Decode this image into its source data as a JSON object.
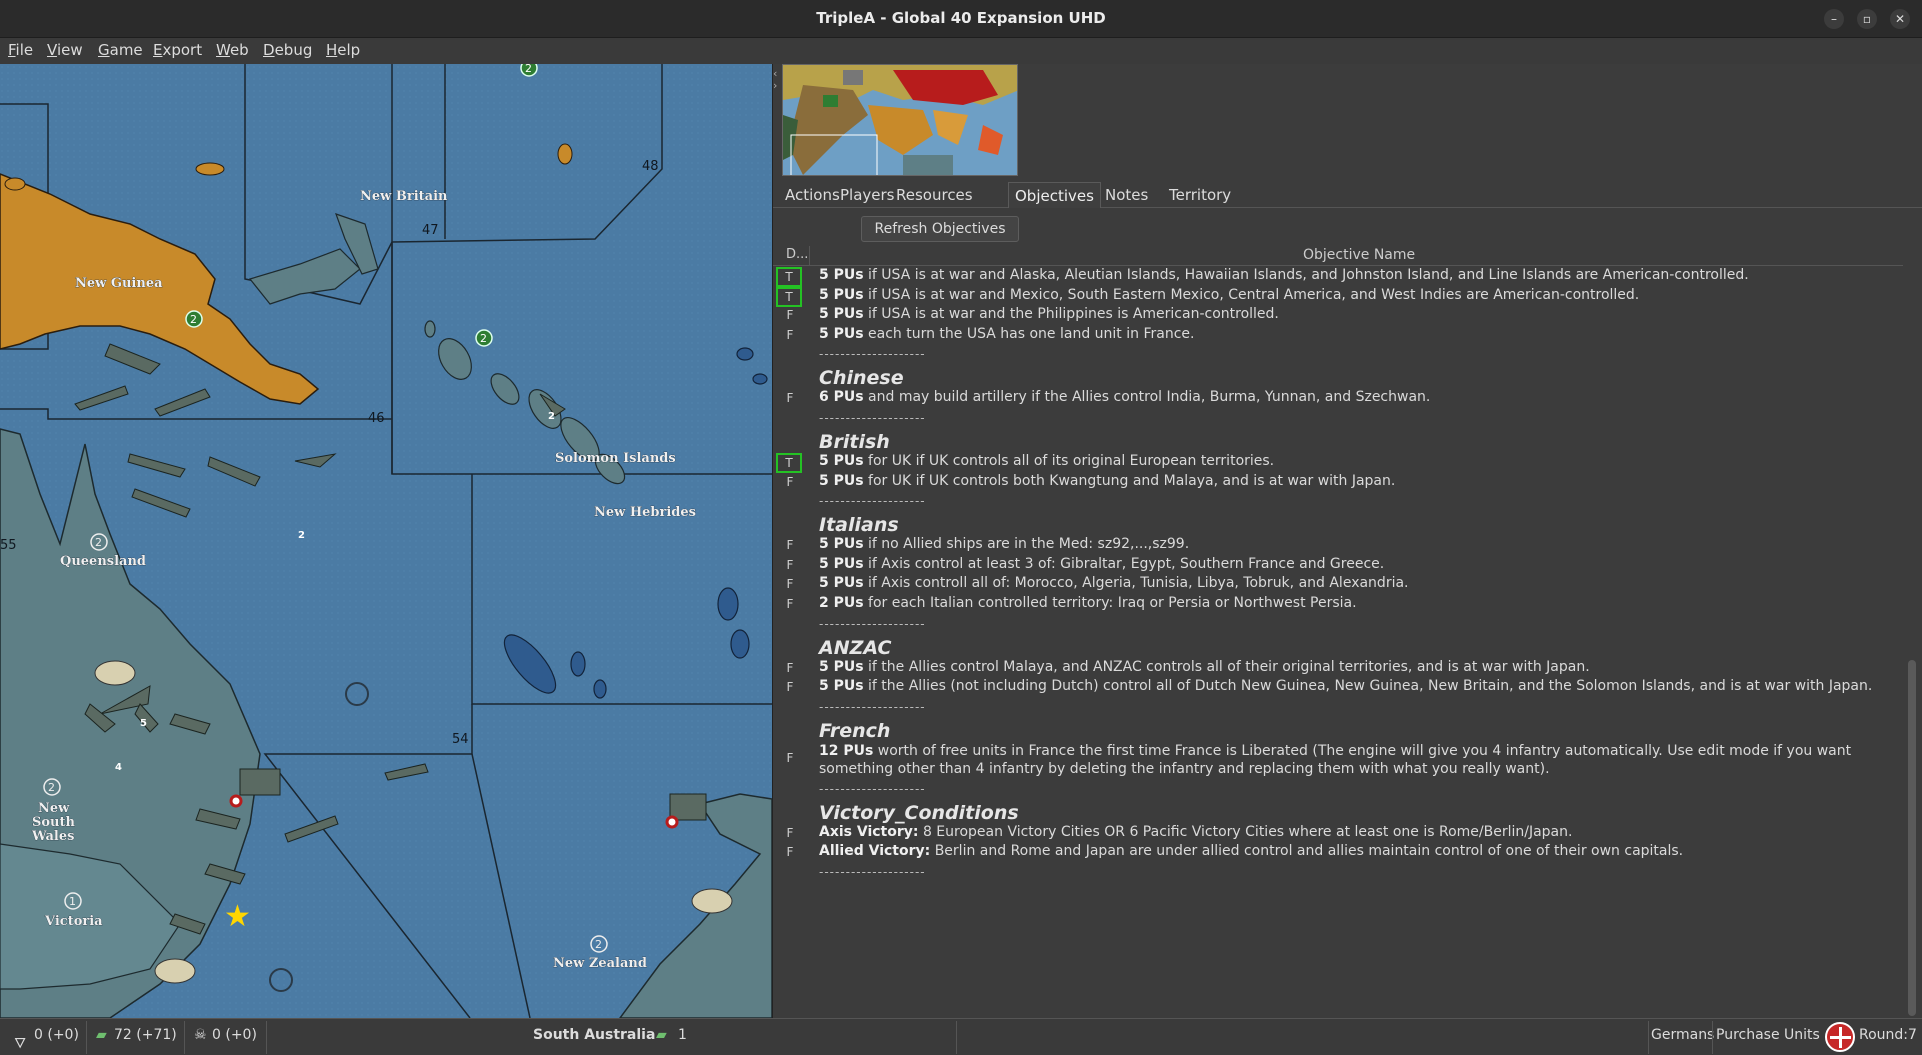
{
  "window": {
    "title": "TripleA - Global 40 Expansion UHD",
    "controls": [
      "–",
      "▫",
      "✕"
    ]
  },
  "menu": [
    "File",
    "View",
    "Game",
    "Export",
    "Web",
    "Debug",
    "Help"
  ],
  "map": {
    "territory_labels": [
      "New Britain",
      "New Guinea",
      "Solomon Islands",
      "New Hebrides",
      "Queensland",
      "New South Wales",
      "Victoria",
      "New Zealand"
    ],
    "sea_zones": [
      "48",
      "47",
      "46",
      "55",
      "54"
    ],
    "production_values": [
      "2",
      "2",
      "2",
      "2",
      "2",
      "1",
      "2"
    ],
    "unit_counts": [
      "2",
      "2",
      "5",
      "4"
    ]
  },
  "tabs": [
    "Actions",
    "Players",
    "Resources",
    "Objectives",
    "Notes",
    "Territory"
  ],
  "active_tab": "Objectives",
  "refresh_button": "Refresh Objectives",
  "objectives_table": {
    "col_done": "D...",
    "col_name": "Objective Name",
    "rows": [
      {
        "kind": "obj",
        "flag": "T",
        "pu": "5 PUs",
        "text": " if USA is at war and Alaska, Aleutian Islands, Hawaiian Islands, and Johnston Island, and Line Islands are American-controlled."
      },
      {
        "kind": "obj",
        "flag": "T",
        "pu": "5 PUs",
        "text": " if USA is at war and Mexico, South Eastern Mexico, Central America, and West Indies are American-controlled."
      },
      {
        "kind": "obj",
        "flag": "F",
        "pu": "5 PUs",
        "text": " if USA is at war and the Philippines is American-controlled."
      },
      {
        "kind": "obj",
        "flag": "F",
        "pu": "5 PUs",
        "text": " each turn the USA has one land unit in France."
      },
      {
        "kind": "sep",
        "text": "--------------------"
      },
      {
        "kind": "heading",
        "text": "Chinese"
      },
      {
        "kind": "obj",
        "flag": "F",
        "pu": "6 PUs",
        "text": " and may build artillery if the Allies control India, Burma, Yunnan, and Szechwan."
      },
      {
        "kind": "sep",
        "text": "--------------------"
      },
      {
        "kind": "heading",
        "text": "British"
      },
      {
        "kind": "obj",
        "flag": "T",
        "pu": "5 PUs",
        "text": " for UK if UK controls all of its original European territories."
      },
      {
        "kind": "obj",
        "flag": "F",
        "pu": "5 PUs",
        "text": " for UK if UK controls both Kwangtung and Malaya, and is at war with Japan."
      },
      {
        "kind": "sep",
        "text": "--------------------"
      },
      {
        "kind": "heading",
        "text": "Italians"
      },
      {
        "kind": "obj",
        "flag": "F",
        "pu": "5 PUs",
        "text": " if no Allied ships are in the Med: sz92,...,sz99."
      },
      {
        "kind": "obj",
        "flag": "F",
        "pu": "5 PUs",
        "text": " if Axis control at least 3 of: Gibraltar, Egypt, Southern France and Greece."
      },
      {
        "kind": "obj",
        "flag": "F",
        "pu": "5 PUs",
        "text": " if Axis controll all of: Morocco, Algeria, Tunisia, Libya, Tobruk, and Alexandria."
      },
      {
        "kind": "obj",
        "flag": "F",
        "pu": "2 PUs",
        "text": " for each Italian controlled territory: Iraq or Persia or Northwest Persia."
      },
      {
        "kind": "sep",
        "text": "--------------------"
      },
      {
        "kind": "heading",
        "text": "ANZAC"
      },
      {
        "kind": "obj",
        "flag": "F",
        "pu": "5 PUs",
        "text": " if the Allies control Malaya, and ANZAC controls all of their original territories, and is at war with Japan."
      },
      {
        "kind": "obj",
        "flag": "F",
        "pu": "5 PUs",
        "text": " if the Allies (not including Dutch) control all of Dutch New Guinea, New Guinea, New Britain, and the Solomon Islands, and is at war with Japan."
      },
      {
        "kind": "sep",
        "text": "--------------------"
      },
      {
        "kind": "heading",
        "text": "French"
      },
      {
        "kind": "objwrap",
        "flag": "F",
        "pu": "12 PUs",
        "text": " worth of free units in France the first time France is Liberated (The engine will give you 4 infantry automatically. Use edit mode if you want something other than 4 infantry by deleting the infantry and replacing them with what you really want)."
      },
      {
        "kind": "sep",
        "text": "--------------------"
      },
      {
        "kind": "heading",
        "text": "Victory_Conditions"
      },
      {
        "kind": "obj",
        "flag": "F",
        "pu": "Axis Victory:",
        "text": " 8 European Victory Cities OR 6 Pacific Victory Cities where at least one is Rome/Berlin/Japan."
      },
      {
        "kind": "obj",
        "flag": "F",
        "pu": "Allied Victory:",
        "text": " Berlin and Rome and Japan are under allied control and allies maintain control of one of their own capitals."
      },
      {
        "kind": "sep",
        "text": "--------------------"
      }
    ]
  },
  "status_bar": {
    "resource1": "0 (+0)",
    "resource2": "72 (+71)",
    "resource3": "0 (+0)",
    "territory": "South Australia",
    "territory_value": "1",
    "player": "Germans",
    "phase": "Purchase Units",
    "round": "Round:7"
  },
  "colors": {
    "sea": "#4a7aa3",
    "japanese_territory": "#c88a2a",
    "anzac_territory": "#5e7f86",
    "objective_true_border": "#24c224",
    "germany_flag": "#c62828"
  }
}
